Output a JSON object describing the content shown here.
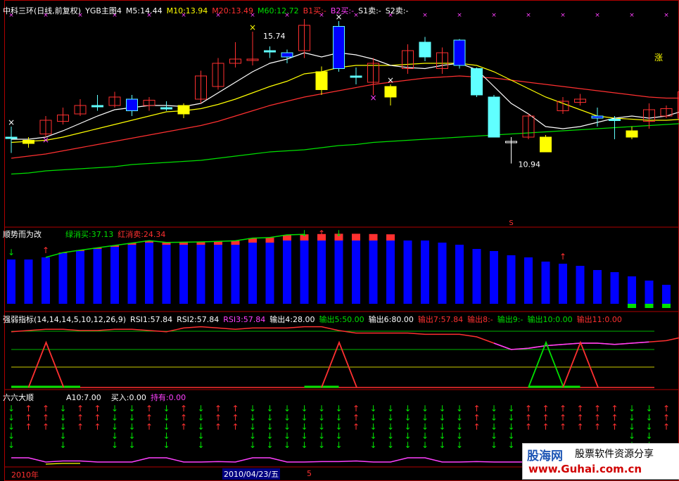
{
  "colors": {
    "bg": "#000000",
    "frame": "#b00000",
    "white": "#ffffff",
    "yellow": "#ffff00",
    "magenta": "#ff40ff",
    "green": "#00e000",
    "red": "#ff3030",
    "blue": "#0000ff",
    "cyan": "#60ffff",
    "up": "#ff3030",
    "down": "#60ffff",
    "grid": "#b00000"
  },
  "main_header": {
    "title": "中科三环(日线,前复权)",
    "indicator": "YGB主图4",
    "m5": "M5:14.44",
    "m10": "M10:13.94",
    "m20": "M20:13.49",
    "m60": "M60:12.72",
    "b1": "B1买:-",
    "b2": "B2买:-",
    "s1": "S1卖:-",
    "s2": "S2卖:-"
  },
  "main_annotations": {
    "high": "15.74",
    "low": "10.94",
    "zhang": "涨",
    "s_mark": "S"
  },
  "panel2_header": {
    "title": "顺势而为改",
    "green": "绿消买:37.13",
    "red": "红消卖:24.34"
  },
  "panel3_header": {
    "title": "强弱指标(14,14,14,5,10,12,26,9)",
    "rsi1": "RSI1:57.84",
    "rsi2": "RSI2:57.84",
    "rsi3": "RSI3:57.84",
    "o4": "输出4:28.00",
    "o5": "输出5:50.00",
    "o6": "输出6:80.00",
    "o7": "输出7:57.84",
    "o8": "输出8:-",
    "o9": "输出9:-",
    "o10": "输出10:0.00",
    "o11": "输出11:0.00"
  },
  "panel4_header": {
    "title": "六六大顺",
    "a10": "A10:7.00",
    "buy": "买入:0.00",
    "hold": "持有:0.00"
  },
  "footer": {
    "year": "2010年",
    "date": "2010/04/23/五",
    "num": "5"
  },
  "watermark": {
    "name": "股海网",
    "slogan": "股票软件资源分享",
    "url": "www.Guhai.com.cn"
  },
  "chart_data": {
    "type": "candlestick",
    "candles": [
      {
        "o": 0.3,
        "c": 0.3,
        "h": 0.4,
        "l": 0.15,
        "kind": "cyan"
      },
      {
        "o": 0.27,
        "c": 0.24,
        "h": 0.3,
        "l": 0.2,
        "kind": "yellow"
      },
      {
        "o": 0.33,
        "c": 0.46,
        "h": 0.5,
        "l": 0.3,
        "kind": "up"
      },
      {
        "o": 0.45,
        "c": 0.51,
        "h": 0.58,
        "l": 0.42,
        "kind": "up"
      },
      {
        "o": 0.52,
        "c": 0.6,
        "h": 0.66,
        "l": 0.5,
        "kind": "up"
      },
      {
        "o": 0.6,
        "c": 0.6,
        "h": 0.7,
        "l": 0.55,
        "kind": "cyan"
      },
      {
        "o": 0.6,
        "c": 0.68,
        "h": 0.73,
        "l": 0.58,
        "kind": "up"
      },
      {
        "o": 0.66,
        "c": 0.55,
        "h": 0.7,
        "l": 0.5,
        "kind": "blue"
      },
      {
        "o": 0.6,
        "c": 0.65,
        "h": 0.68,
        "l": 0.55,
        "kind": "up"
      },
      {
        "o": 0.58,
        "c": 0.57,
        "h": 0.64,
        "l": 0.55,
        "kind": "cyan"
      },
      {
        "o": 0.6,
        "c": 0.52,
        "h": 0.62,
        "l": 0.48,
        "kind": "yellow"
      },
      {
        "o": 0.66,
        "c": 0.88,
        "h": 0.93,
        "l": 0.62,
        "kind": "up"
      },
      {
        "o": 0.78,
        "c": 1.0,
        "h": 1.05,
        "l": 0.75,
        "kind": "up"
      },
      {
        "o": 1.0,
        "c": 1.04,
        "h": 1.2,
        "l": 0.96,
        "kind": "up"
      },
      {
        "o": 1.04,
        "c": 1.04,
        "h": 1.3,
        "l": 0.98,
        "kind": "up"
      },
      {
        "o": 1.12,
        "c": 1.12,
        "h": 1.16,
        "l": 1.05,
        "kind": "cyan"
      },
      {
        "o": 1.1,
        "c": 1.06,
        "h": 1.13,
        "l": 1.0,
        "kind": "blue"
      },
      {
        "o": 1.12,
        "c": 1.36,
        "h": 1.42,
        "l": 1.05,
        "kind": "up"
      },
      {
        "o": 0.92,
        "c": 0.75,
        "h": 0.97,
        "l": 0.7,
        "kind": "yellow"
      },
      {
        "o": 1.35,
        "c": 0.95,
        "h": 1.4,
        "l": 0.92,
        "kind": "blue"
      },
      {
        "o": 0.88,
        "c": 0.88,
        "h": 0.96,
        "l": 0.8,
        "kind": "cyan"
      },
      {
        "o": 0.82,
        "c": 1.0,
        "h": 1.05,
        "l": 0.7,
        "kind": "up"
      },
      {
        "o": 0.78,
        "c": 0.68,
        "h": 0.8,
        "l": 0.6,
        "kind": "yellow"
      },
      {
        "o": 0.95,
        "c": 1.12,
        "h": 1.18,
        "l": 0.9,
        "kind": "up"
      },
      {
        "o": 1.2,
        "c": 1.06,
        "h": 1.25,
        "l": 1.02,
        "kind": "cyan"
      },
      {
        "o": 0.95,
        "c": 1.1,
        "h": 1.15,
        "l": 0.9,
        "kind": "up"
      },
      {
        "o": 1.22,
        "c": 0.98,
        "h": 1.23,
        "l": 0.95,
        "kind": "blue"
      },
      {
        "o": 0.95,
        "c": 0.7,
        "h": 0.96,
        "l": 0.68,
        "kind": "cyan"
      },
      {
        "o": 0.68,
        "c": 0.3,
        "h": 0.7,
        "l": 0.3,
        "kind": "cyan"
      },
      {
        "o": 0.26,
        "c": 0.26,
        "h": 0.3,
        "l": 0.05,
        "kind": "cross"
      },
      {
        "o": 0.3,
        "c": 0.5,
        "h": 0.52,
        "l": 0.28,
        "kind": "up"
      },
      {
        "o": 0.3,
        "c": 0.16,
        "h": 0.32,
        "l": 0.16,
        "kind": "yellow"
      },
      {
        "o": 0.55,
        "c": 0.64,
        "h": 0.68,
        "l": 0.52,
        "kind": "up"
      },
      {
        "o": 0.63,
        "c": 0.66,
        "h": 0.71,
        "l": 0.6,
        "kind": "up"
      },
      {
        "o": 0.5,
        "c": 0.48,
        "h": 0.58,
        "l": 0.4,
        "kind": "blue"
      },
      {
        "o": 0.47,
        "c": 0.46,
        "h": 0.5,
        "l": 0.28,
        "kind": "cyan"
      },
      {
        "o": 0.36,
        "c": 0.3,
        "h": 0.4,
        "l": 0.28,
        "kind": "yellow"
      },
      {
        "o": 0.45,
        "c": 0.56,
        "h": 0.62,
        "l": 0.38,
        "kind": "up"
      },
      {
        "o": 0.5,
        "c": 0.57,
        "h": 0.6,
        "l": 0.48,
        "kind": "up"
      },
      {
        "o": 0.48,
        "c": 0.73,
        "h": 0.8,
        "l": 0.45,
        "kind": "up"
      },
      {
        "o": 0.8,
        "c": 0.82,
        "h": 0.88,
        "l": 0.75,
        "kind": "up"
      },
      {
        "o": 0.82,
        "c": 0.93,
        "h": 0.98,
        "l": 0.8,
        "kind": "up"
      },
      {
        "o": 0.93,
        "c": 0.99,
        "h": 1.1,
        "l": 0.9,
        "kind": "up"
      },
      {
        "o": 1.0,
        "c": 1.04,
        "h": 1.06,
        "l": 0.96,
        "kind": "up"
      },
      {
        "o": 1.03,
        "c": 0.98,
        "h": 1.06,
        "l": 0.94,
        "kind": "blue"
      },
      {
        "o": 0.95,
        "c": 0.83,
        "h": 0.96,
        "l": 0.82,
        "kind": "yellow"
      },
      {
        "o": 1.05,
        "c": 1.2,
        "h": 1.28,
        "l": 1.02,
        "kind": "up"
      },
      {
        "o": 1.24,
        "c": 1.18,
        "h": 1.26,
        "l": 1.16,
        "kind": "cyan"
      },
      {
        "o": 1.18,
        "c": 1.04,
        "h": 1.2,
        "l": 1.02,
        "kind": "blue"
      },
      {
        "o": 1.02,
        "c": 1.1,
        "h": 1.13,
        "l": 1.0,
        "kind": "up"
      }
    ],
    "ma5": [
      0.28,
      0.28,
      0.3,
      0.36,
      0.43,
      0.5,
      0.56,
      0.58,
      0.6,
      0.6,
      0.59,
      0.62,
      0.72,
      0.82,
      0.92,
      1.0,
      1.04,
      1.1,
      1.06,
      1.1,
      1.08,
      1.04,
      0.98,
      0.96,
      0.95,
      0.98,
      1.0,
      0.94,
      0.78,
      0.62,
      0.52,
      0.4,
      0.38,
      0.4,
      0.44,
      0.48,
      0.5,
      0.48,
      0.5,
      0.55,
      0.62,
      0.68,
      0.76,
      0.86,
      0.92,
      0.94,
      0.98,
      1.04,
      1.08,
      1.1
    ],
    "ma10": [
      0.25,
      0.26,
      0.27,
      0.3,
      0.34,
      0.38,
      0.42,
      0.46,
      0.5,
      0.54,
      0.55,
      0.57,
      0.61,
      0.66,
      0.72,
      0.78,
      0.83,
      0.9,
      0.92,
      0.96,
      0.98,
      0.98,
      0.98,
      0.99,
      1.0,
      1.0,
      1.0,
      0.98,
      0.92,
      0.84,
      0.76,
      0.68,
      0.62,
      0.56,
      0.5,
      0.48,
      0.47,
      0.46,
      0.46,
      0.47,
      0.5,
      0.54,
      0.58,
      0.64,
      0.7,
      0.75,
      0.8,
      0.86,
      0.9,
      0.94
    ],
    "ma20": [
      0.1,
      0.12,
      0.14,
      0.17,
      0.2,
      0.23,
      0.26,
      0.29,
      0.32,
      0.35,
      0.38,
      0.41,
      0.45,
      0.5,
      0.55,
      0.6,
      0.64,
      0.68,
      0.71,
      0.74,
      0.77,
      0.8,
      0.82,
      0.84,
      0.86,
      0.87,
      0.88,
      0.87,
      0.86,
      0.84,
      0.82,
      0.8,
      0.78,
      0.76,
      0.74,
      0.72,
      0.7,
      0.68,
      0.67,
      0.67,
      0.68,
      0.7,
      0.72,
      0.74,
      0.76,
      0.78,
      0.8,
      0.82,
      0.83,
      0.84
    ],
    "ma60": [
      -0.05,
      -0.04,
      -0.02,
      -0.01,
      0.0,
      0.01,
      0.02,
      0.04,
      0.05,
      0.06,
      0.07,
      0.08,
      0.1,
      0.12,
      0.14,
      0.16,
      0.17,
      0.18,
      0.2,
      0.22,
      0.23,
      0.25,
      0.26,
      0.27,
      0.28,
      0.29,
      0.3,
      0.31,
      0.32,
      0.33,
      0.34,
      0.35,
      0.36,
      0.37,
      0.38,
      0.39,
      0.4,
      0.41,
      0.42,
      0.43,
      0.44,
      0.45,
      0.46,
      0.47,
      0.48,
      0.49,
      0.5,
      0.51,
      0.52,
      0.53
    ],
    "bars": [
      0.42,
      0.42,
      0.44,
      0.48,
      0.5,
      0.52,
      0.54,
      0.56,
      0.58,
      0.56,
      0.56,
      0.56,
      0.56,
      0.56,
      0.58,
      0.58,
      0.6,
      0.6,
      0.6,
      0.6,
      0.6,
      0.6,
      0.6,
      0.6,
      0.6,
      0.58,
      0.56,
      0.52,
      0.5,
      0.46,
      0.44,
      0.4,
      0.38,
      0.36,
      0.32,
      0.3,
      0.26,
      0.22,
      0.18,
      0.16,
      0.14,
      0.14,
      0.14,
      0.18,
      0.2,
      0.22,
      0.24,
      0.24,
      0.24,
      0.24
    ],
    "bar_overlay": [
      0,
      0,
      0,
      0.04,
      0.06,
      0.08,
      0.1,
      0.12,
      0.14,
      0.16,
      0.18,
      0.2,
      0.24,
      0.28,
      0.32,
      0.36,
      0.4,
      0.44,
      0.46,
      0.48,
      0.48,
      0.46,
      0.44,
      0,
      0,
      0,
      0,
      0,
      0,
      0,
      0,
      0,
      0,
      0,
      0,
      0,
      0,
      0,
      0,
      0,
      0,
      0,
      0,
      0.14,
      0.18,
      0.2,
      0.22,
      0.24,
      0.26,
      0.28
    ],
    "rsi_line": [
      0.88,
      0.9,
      0.92,
      0.92,
      0.9,
      0.9,
      0.92,
      0.92,
      0.9,
      0.88,
      0.94,
      0.96,
      0.94,
      0.92,
      0.94,
      0.94,
      0.94,
      0.96,
      0.96,
      0.9,
      0.86,
      0.86,
      0.86,
      0.86,
      0.84,
      0.84,
      0.84,
      0.8,
      0.7,
      0.6,
      0.62,
      0.66,
      0.68,
      0.7,
      0.7,
      0.68,
      0.7,
      0.72,
      0.74,
      0.8,
      0.84,
      0.84,
      0.84,
      0.84,
      0.84,
      0.84,
      0.84,
      0.84,
      0.84,
      0.84
    ],
    "spikes": [
      {
        "i": 1,
        "color": "red"
      },
      {
        "i": 4,
        "color": "none"
      },
      {
        "i": 18,
        "color": "red"
      },
      {
        "i": 30,
        "color": "green"
      },
      {
        "i": 32,
        "color": "red"
      }
    ],
    "arrows": [
      "d",
      "u",
      "u",
      "d",
      "u",
      "u",
      "d",
      "d",
      "u",
      "d",
      "u",
      "d",
      "u",
      "u",
      "d",
      "d",
      "d",
      "d",
      "d",
      "d",
      "u",
      "d",
      "d",
      "d",
      "d",
      "d",
      "d",
      "u",
      "d",
      "d",
      "u",
      "u",
      "u",
      "u",
      "u",
      "u",
      "d",
      "d",
      "u",
      "u",
      "u",
      "u",
      "u",
      "d",
      "u",
      "u",
      "u",
      "u",
      "u",
      "u"
    ],
    "bottom_line": [
      0.3,
      0.3,
      0.1,
      0.15,
      0.15,
      0.1,
      0.1,
      0.1,
      0.3,
      0.3,
      0.1,
      0.1,
      0.12,
      0.1,
      0.3,
      0.3,
      0.1,
      0.1,
      0.12,
      0.12,
      0.15,
      0.1,
      0.1,
      0.3,
      0.3,
      0.1,
      0.1,
      0.12,
      0.1,
      0.1,
      0.1,
      0.1,
      0.1,
      0.1,
      0.1,
      0.1,
      0.1,
      0.1,
      0.1,
      0.1,
      0.1,
      0.1,
      0.1,
      0.1,
      0.1,
      0.1,
      0.1,
      0.1,
      0.3,
      0.1
    ]
  }
}
